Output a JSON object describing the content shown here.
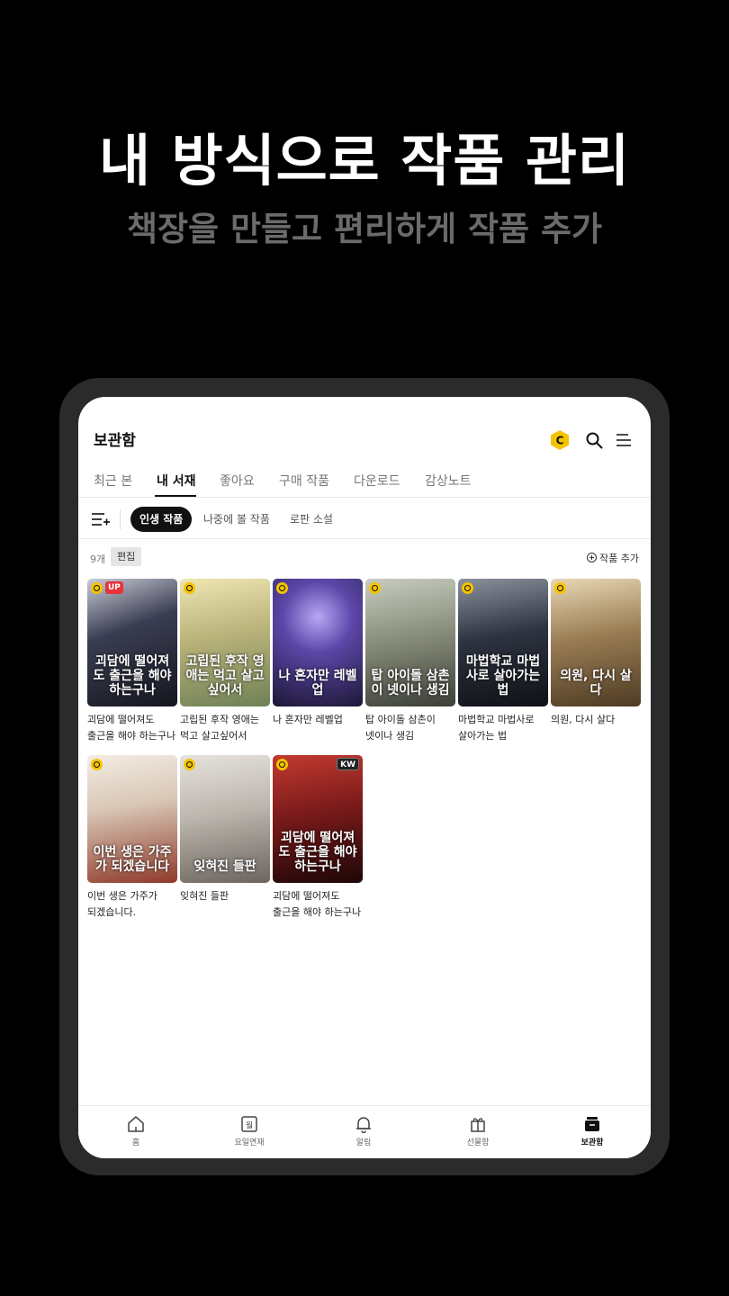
{
  "promo": {
    "title": "내 방식으로 작품 관리",
    "subtitle": "책장을 만들고 편리하게 작품 추가"
  },
  "header": {
    "title": "보관함",
    "coin_letter": "C",
    "coin_icon": "coin-icon",
    "search_icon": "search-icon",
    "menu_icon": "menu-icon"
  },
  "tabs": [
    {
      "label": "최근 본",
      "active": false
    },
    {
      "label": "내 서재",
      "active": true
    },
    {
      "label": "좋아요",
      "active": false
    },
    {
      "label": "구매 작품",
      "active": false
    },
    {
      "label": "다운로드",
      "active": false
    },
    {
      "label": "감상노트",
      "active": false
    }
  ],
  "shelves": [
    {
      "label": "인생 작품",
      "active": true
    },
    {
      "label": "나중에 볼 작품",
      "active": false
    },
    {
      "label": "로판 소설",
      "active": false
    }
  ],
  "list": {
    "count": "9개",
    "edit_label": "편집",
    "add_label": "작품 추가"
  },
  "works": [
    {
      "title": "괴담에 떨어져도 출근을 해야 하는구나",
      "cover_text": "괴담에 떨어져도 출근을 해야 하는구나",
      "badge": "UP",
      "accent": "#3a3d52"
    },
    {
      "title": "고립된 후작 영애는 먹고 살고싶어서",
      "cover_text": "고립된 후작 영애는 먹고 살고 싶어서",
      "badge": "",
      "accent": "#b9b27a"
    },
    {
      "title": "나 혼자만 레벨업",
      "cover_text": "나 혼자만 레벨업",
      "badge": "",
      "accent": "#3c2f6b"
    },
    {
      "title": "탑 아이돌 삼촌이 넷이나 생김",
      "cover_text": "탑 아이돌 삼촌이 넷이나 생김",
      "badge": "",
      "accent": "#8a8f7c"
    },
    {
      "title": "마법학교 마법사로 살아가는 법",
      "cover_text": "마법학교 마법사로 살아가는 법",
      "badge": "",
      "accent": "#2d3340"
    },
    {
      "title": "의원, 다시 살다",
      "cover_text": "의원, 다시 살다",
      "badge": "",
      "accent": "#9a7d54"
    },
    {
      "title": "이번 생은 가주가 되겠습니다.",
      "cover_text": "이번 생은 가주가 되겠습니다",
      "badge": "",
      "accent": "#d9c7b6"
    },
    {
      "title": "잊혀진 들판",
      "cover_text": "잊혀진 들판",
      "badge": "",
      "accent": "#bdb6ae"
    },
    {
      "title": "괴담에 떨어져도 출근을 해야 하는구나",
      "cover_text": "괴담에 떨어져도 출근을 해야 하는구나",
      "badge": "KW",
      "accent": "#7a1a1a"
    }
  ],
  "bottom_nav": [
    {
      "label": "홈",
      "icon": "home-icon",
      "active": false
    },
    {
      "label": "요일연재",
      "icon": "calendar-icon",
      "active": false
    },
    {
      "label": "알림",
      "icon": "bell-icon",
      "active": false
    },
    {
      "label": "선물함",
      "icon": "gift-icon",
      "active": false
    },
    {
      "label": "보관함",
      "icon": "library-icon",
      "active": true
    }
  ],
  "calendar_icon_text": "월"
}
